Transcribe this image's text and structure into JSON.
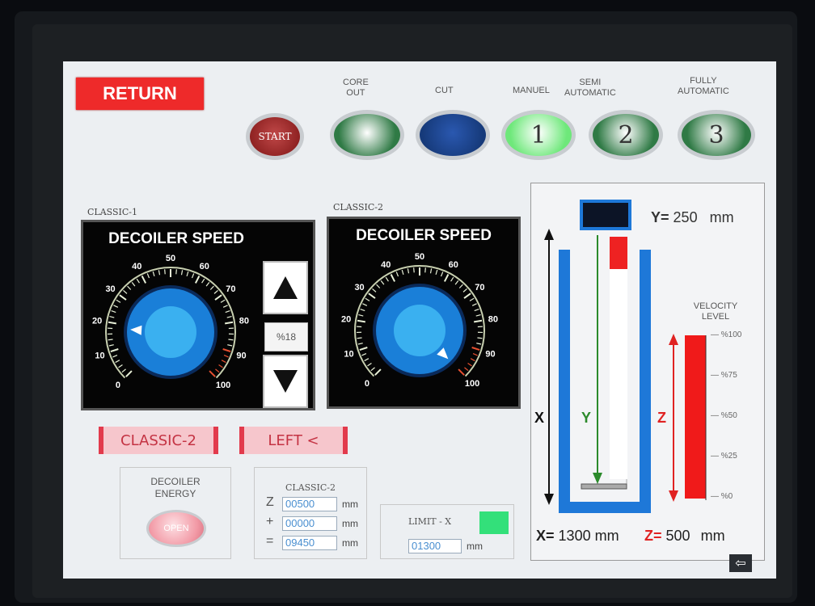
{
  "header": {
    "return_label": "RETURN"
  },
  "lamps": [
    {
      "label": "",
      "text": "START",
      "color": "#8b1f1f"
    },
    {
      "label": "CORE\nOUT",
      "text": "",
      "color": "#2f7a45"
    },
    {
      "label": "CUT",
      "text": "",
      "color": "#163a7a"
    },
    {
      "label": "MANUEL",
      "text": "1",
      "color": "#6ee87a"
    },
    {
      "label": "SEMI\nAUTOMATIC",
      "text": "2",
      "color": "#2f7a45"
    },
    {
      "label": "FULLY\nAUTOMATIC",
      "text": "3",
      "color": "#2f7a45"
    }
  ],
  "dial1": {
    "panel_label": "CLASSIC-1",
    "title": "DECOILER SPEED",
    "value_pct": 18,
    "pct_text": "%18"
  },
  "dial2": {
    "panel_label": "CLASSIC-2",
    "title": "DECOILER SPEED",
    "value_pct": 100
  },
  "dial_ticks": [
    "0",
    "10",
    "20",
    "30",
    "40",
    "50",
    "60",
    "70",
    "80",
    "90",
    "100"
  ],
  "controls": {
    "mode_button": "CLASSIC-2",
    "direction_button": "LEFT <"
  },
  "energy": {
    "title": "DECOILER\nENERGY",
    "button": "OPEN"
  },
  "classic_box": {
    "title": "CLASSIC-2",
    "rows": [
      {
        "sym": "Z",
        "value": "00500",
        "unit": "mm"
      },
      {
        "sym": "+",
        "value": "00000",
        "unit": "mm"
      },
      {
        "sym": "=",
        "value": "09450",
        "unit": "mm"
      }
    ]
  },
  "limit_box": {
    "title": "LIMIT - X",
    "value": "01300",
    "unit": "mm",
    "indicator_color": "#33e07a"
  },
  "diagram": {
    "y_label": "Y=",
    "y_value": "250",
    "y_unit": "mm",
    "x_axis": "X",
    "y_axis": "Y",
    "z_axis": "Z",
    "x_label": "X=",
    "x_value": "1300",
    "x_unit": "mm",
    "z_label": "Z=",
    "z_value": "500",
    "z_unit": "mm",
    "velocity_title": "VELOCITY\nLEVEL",
    "velocity_ticks": [
      "%100",
      "%75",
      "%50",
      "%25",
      "%0"
    ]
  }
}
